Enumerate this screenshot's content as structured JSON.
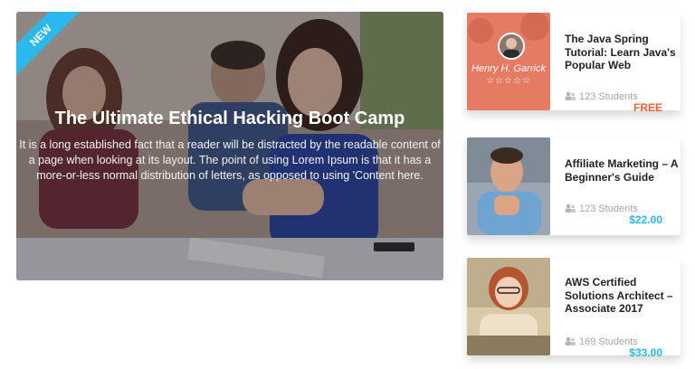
{
  "hero": {
    "badge": "NEW",
    "title": "The Ultimate Ethical Hacking Boot Camp",
    "description": "It is a long established fact that a reader will be distracted by the readable content of a page when looking at its layout. The point of using Lorem Ipsum is that it has a more-or-less normal distribution of letters, as opposed to using 'Content here."
  },
  "courses": [
    {
      "title": "The Java Spring Tutorial: Learn Java's Popular Web",
      "instructor": "Henry H. Garrick",
      "rating_stars": "☆☆☆☆☆",
      "students": "123 Students",
      "price": "FREE"
    },
    {
      "title": "Affiliate Marketing – A Beginner's Guide",
      "students": "123 Students",
      "price": "$22.00"
    },
    {
      "title": "AWS Certified Solutions Architect – Associate 2017",
      "students": "169 Students",
      "price": "$33.00"
    }
  ],
  "colors": {
    "accent": "#29b9ee",
    "free": "#e8613a"
  }
}
